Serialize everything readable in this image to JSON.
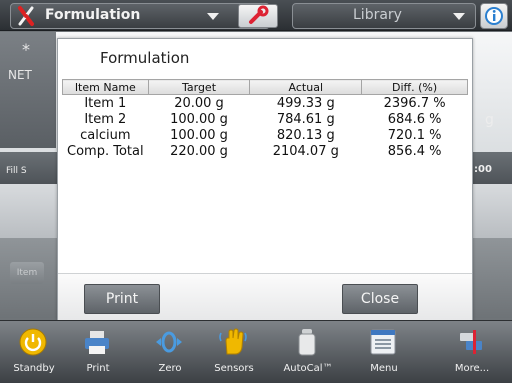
{
  "header": {
    "app_title": "Formulation",
    "library_title": "Library"
  },
  "background": {
    "star": "*",
    "net_label": "NET",
    "unit": "g",
    "fill_label": "Fill S",
    "value_fragment": ":00",
    "small_button": "Item"
  },
  "dialog": {
    "title": "Formulation",
    "columns": [
      "Item Name",
      "Target",
      "Actual",
      "Diff. (%)"
    ],
    "rows": [
      {
        "name": "Item 1",
        "target": "20.00 g",
        "actual": "499.33 g",
        "diff": "2396.7 %"
      },
      {
        "name": "Item 2",
        "target": "100.00 g",
        "actual": "784.61 g",
        "diff": "684.6 %"
      },
      {
        "name": "calcium",
        "target": "100.00 g",
        "actual": "820.13 g",
        "diff": "720.1 %"
      },
      {
        "name": "Comp. Total",
        "target": "220.00 g",
        "actual": "2104.07 g",
        "diff": "856.4 %"
      }
    ],
    "print_label": "Print",
    "close_label": "Close"
  },
  "toolbar": {
    "items": [
      {
        "label": "Standby",
        "icon": "power-icon"
      },
      {
        "label": "Print",
        "icon": "printer-icon"
      },
      {
        "label": "Zero",
        "icon": "zero-icon"
      },
      {
        "label": "Sensors",
        "icon": "hand-sensor-icon"
      },
      {
        "label": "AutoCal™",
        "icon": "autocal-weight-icon"
      },
      {
        "label": "Menu",
        "icon": "menu-list-icon"
      },
      {
        "label": "More...",
        "icon": "more-icon"
      }
    ]
  },
  "colors": {
    "accent_yellow": "#f0b800",
    "dialog_bg": "#ffffff",
    "button_gray": "#6e7378"
  }
}
